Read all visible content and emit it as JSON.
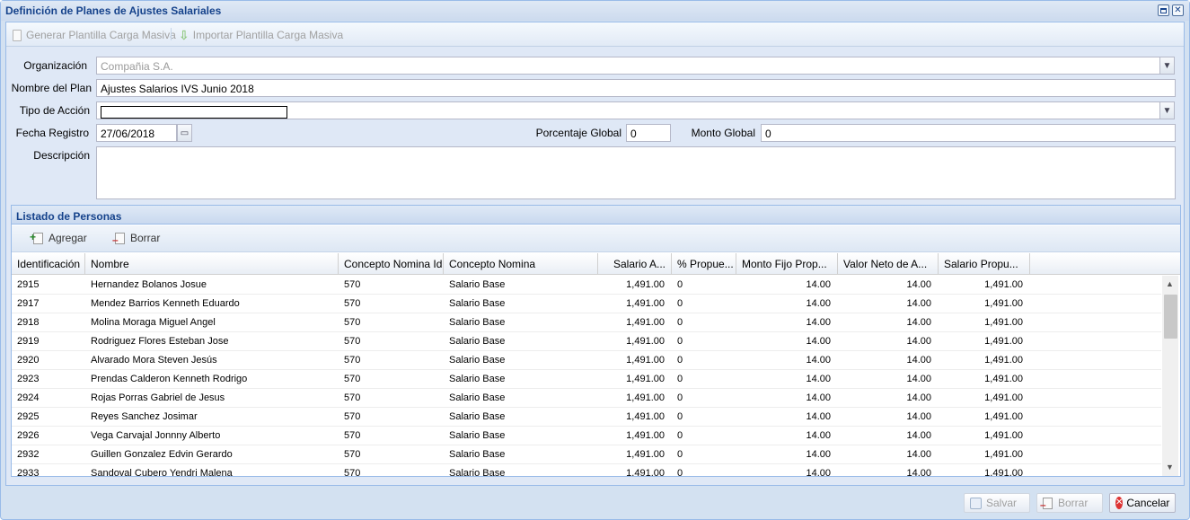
{
  "window": {
    "title": "Definición de Planes de Ajustes Salariales"
  },
  "toolbar": {
    "generate_label": "Generar Plantilla Carga Masiva",
    "import_label": "Importar Plantilla Carga Masiva"
  },
  "form": {
    "organizacion_label": "Organización",
    "organizacion_value": "Compañia S.A.",
    "nombre_label": "Nombre del Plan",
    "nombre_value": "Ajustes Salarios IVS Junio 2018",
    "tipo_label": "Tipo de Acción",
    "tipo_value": "",
    "fecha_label": "Fecha Registro",
    "fecha_value": "27/06/2018",
    "porcentaje_label": "Porcentaje Global",
    "porcentaje_value": "0",
    "monto_label": "Monto Global",
    "monto_value": "0",
    "descripcion_label": "Descripción"
  },
  "grid": {
    "title": "Listado de Personas",
    "add_label": "Agregar",
    "delete_label": "Borrar",
    "columns": [
      "Identificación",
      "Nombre",
      "Concepto Nomina Id",
      "Concepto Nomina",
      "Salario A...",
      "% Propue...",
      "Monto Fijo Prop...",
      "Valor Neto de A...",
      "Salario Propu..."
    ],
    "rows": [
      [
        "2915",
        "Hernandez Bolanos Josue",
        "570",
        "Salario Base",
        "1,491.00",
        "0",
        "14.00",
        "14.00",
        "1,491.00"
      ],
      [
        "2917",
        "Mendez Barrios Kenneth Eduardo",
        "570",
        "Salario Base",
        "1,491.00",
        "0",
        "14.00",
        "14.00",
        "1,491.00"
      ],
      [
        "2918",
        "Molina Moraga Miguel Angel",
        "570",
        "Salario Base",
        "1,491.00",
        "0",
        "14.00",
        "14.00",
        "1,491.00"
      ],
      [
        "2919",
        "Rodriguez Flores Esteban Jose",
        "570",
        "Salario Base",
        "1,491.00",
        "0",
        "14.00",
        "14.00",
        "1,491.00"
      ],
      [
        "2920",
        "Alvarado Mora Steven Jesús",
        "570",
        "Salario Base",
        "1,491.00",
        "0",
        "14.00",
        "14.00",
        "1,491.00"
      ],
      [
        "2923",
        "Prendas Calderon Kenneth Rodrigo",
        "570",
        "Salario Base",
        "1,491.00",
        "0",
        "14.00",
        "14.00",
        "1,491.00"
      ],
      [
        "2924",
        "Rojas Porras Gabriel de Jesus",
        "570",
        "Salario Base",
        "1,491.00",
        "0",
        "14.00",
        "14.00",
        "1,491.00"
      ],
      [
        "2925",
        "Reyes Sanchez Josimar",
        "570",
        "Salario Base",
        "1,491.00",
        "0",
        "14.00",
        "14.00",
        "1,491.00"
      ],
      [
        "2926",
        "Vega Carvajal Jonnny Alberto",
        "570",
        "Salario Base",
        "1,491.00",
        "0",
        "14.00",
        "14.00",
        "1,491.00"
      ],
      [
        "2932",
        "Guillen Gonzalez Edvin Gerardo",
        "570",
        "Salario Base",
        "1,491.00",
        "0",
        "14.00",
        "14.00",
        "1,491.00"
      ],
      [
        "2933",
        "Sandoval Cubero Yendri Malena",
        "570",
        "Salario Base",
        "1,491.00",
        "0",
        "14.00",
        "14.00",
        "1,491.00"
      ]
    ]
  },
  "footer": {
    "save_label": "Salvar",
    "delete_label": "Borrar",
    "cancel_label": "Cancelar"
  }
}
